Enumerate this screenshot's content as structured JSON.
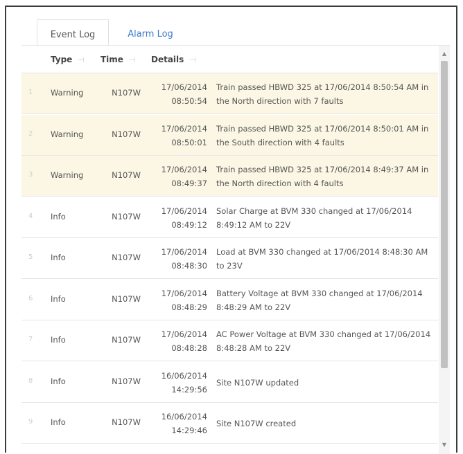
{
  "tabs": [
    {
      "label": "Event Log",
      "active": true
    },
    {
      "label": "Alarm Log",
      "active": false
    }
  ],
  "columns": {
    "type": "Type",
    "time": "Time",
    "details": "Details"
  },
  "rows": [
    {
      "num": "1",
      "type": "Warning",
      "site": "N107W",
      "date": "17/06/2014",
      "clock": "08:50:54",
      "details": "Train passed HBWD 325 at 17/06/2014 8:50:54 AM in the North direction with 7 faults",
      "severity": "warning"
    },
    {
      "num": "2",
      "type": "Warning",
      "site": "N107W",
      "date": "17/06/2014",
      "clock": "08:50:01",
      "details": "Train passed HBWD 325 at 17/06/2014 8:50:01 AM in the South direction with 4 faults",
      "severity": "warning"
    },
    {
      "num": "3",
      "type": "Warning",
      "site": "N107W",
      "date": "17/06/2014",
      "clock": "08:49:37",
      "details": "Train passed HBWD 325 at 17/06/2014 8:49:37 AM in the North direction with 4 faults",
      "severity": "warning"
    },
    {
      "num": "4",
      "type": "Info",
      "site": "N107W",
      "date": "17/06/2014",
      "clock": "08:49:12",
      "details": "Solar Charge at BVM 330 changed at 17/06/2014 8:49:12 AM to 22V",
      "severity": "info"
    },
    {
      "num": "5",
      "type": "Info",
      "site": "N107W",
      "date": "17/06/2014",
      "clock": "08:48:30",
      "details": "Load at BVM 330 changed at 17/06/2014 8:48:30 AM to 23V",
      "severity": "info"
    },
    {
      "num": "6",
      "type": "Info",
      "site": "N107W",
      "date": "17/06/2014",
      "clock": "08:48:29",
      "details": "Battery Voltage at BVM 330 changed at 17/06/2014 8:48:29 AM to 22V",
      "severity": "info"
    },
    {
      "num": "7",
      "type": "Info",
      "site": "N107W",
      "date": "17/06/2014",
      "clock": "08:48:28",
      "details": "AC Power Voltage at BVM 330 changed at 17/06/2014 8:48:28 AM to 22V",
      "severity": "info"
    },
    {
      "num": "8",
      "type": "Info",
      "site": "N107W",
      "date": "16/06/2014",
      "clock": "14:29:56",
      "details": "Site N107W updated",
      "severity": "info"
    },
    {
      "num": "9",
      "type": "Info",
      "site": "N107W",
      "date": "16/06/2014",
      "clock": "14:29:46",
      "details": "Site N107W created",
      "severity": "info"
    }
  ],
  "icons": {
    "column_grip": "column-resize-grip-icon",
    "scroll_up": "scroll-up-arrow-icon",
    "scroll_down": "scroll-down-arrow-icon"
  },
  "colors": {
    "warning_row": "#fbf7e4",
    "info_row": "#ffffff",
    "tab_link": "#3d7ac9"
  }
}
